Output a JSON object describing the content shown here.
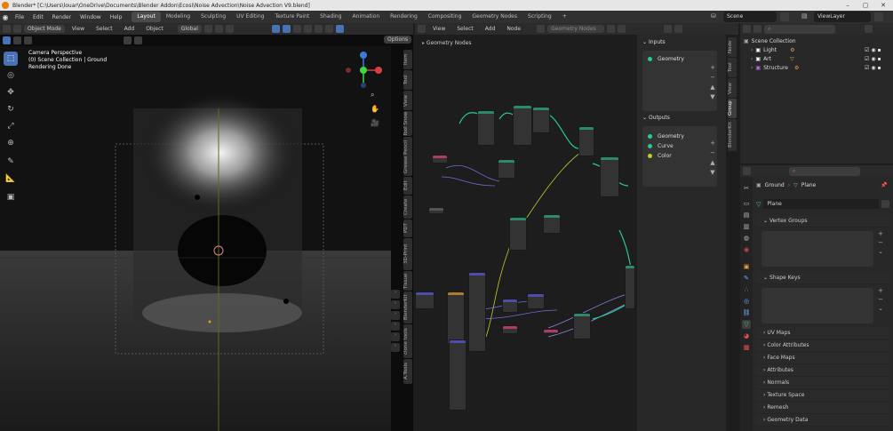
{
  "window": {
    "title": "Blender* [C:\\Users\\louar\\OneDrive\\Documents\\Blender Addon\\Ecosi\\Noise Advection\\Noise Advection V9.blend]"
  },
  "menu": [
    "File",
    "Edit",
    "Render",
    "Window",
    "Help"
  ],
  "workspaces": [
    "Layout",
    "Modeling",
    "Sculpting",
    "UV Editing",
    "Texture Paint",
    "Shading",
    "Animation",
    "Rendering",
    "Compositing",
    "Geometry Nodes",
    "Scripting",
    "+"
  ],
  "scene": {
    "name": "Scene",
    "view_layer": "ViewLayer"
  },
  "viewport": {
    "mode": "Object Mode",
    "menu": [
      "View",
      "Select",
      "Add",
      "Object"
    ],
    "transform": "Global",
    "options": "Options",
    "overlay_lines": [
      "Camera Perspective",
      "(0) Scene Collection | Ground",
      "Rendering Done"
    ],
    "side_tabs": [
      "Item",
      "Tool",
      "View",
      "Tool Snow",
      "Grease Pencil",
      "Edit",
      "Create",
      "PDT",
      "3D-Print",
      "Tissue",
      "BlenderKit",
      "clone tools",
      "A.Tools"
    ]
  },
  "node_editor": {
    "menu": [
      "View",
      "Select",
      "Add",
      "Node"
    ],
    "tree_name": "Geometry Nodes",
    "breadcrumb": "Geometry Nodes",
    "inputs_title": "Inputs",
    "inputs": [
      {
        "name": "Geometry",
        "color": "#27c99a"
      }
    ],
    "outputs_title": "Outputs",
    "outputs": [
      {
        "name": "Geometry",
        "color": "#27c99a"
      },
      {
        "name": "Curve",
        "color": "#27c99a"
      },
      {
        "name": "Color",
        "color": "#c7c729"
      }
    ],
    "side_tabs": [
      "Node",
      "Tool",
      "View",
      "Group",
      "BlenderKit"
    ]
  },
  "outliner": {
    "root": "Scene Collection",
    "items": [
      "Light",
      "Art",
      "Structure"
    ]
  },
  "properties": {
    "breadcrumb_object": "Ground",
    "breadcrumb_data": "Plane",
    "mesh_name": "Plane",
    "sections_open": [
      "Vertex Groups",
      "Shape Keys"
    ],
    "sections_closed": [
      "UV Maps",
      "Color Attributes",
      "Face Maps",
      "Attributes",
      "Normals",
      "Texture Space",
      "Remesh",
      "Geometry Data"
    ]
  },
  "colors": {
    "accent": "#4772b3",
    "geometry_socket": "#27c99a",
    "color_socket": "#c7c729"
  }
}
